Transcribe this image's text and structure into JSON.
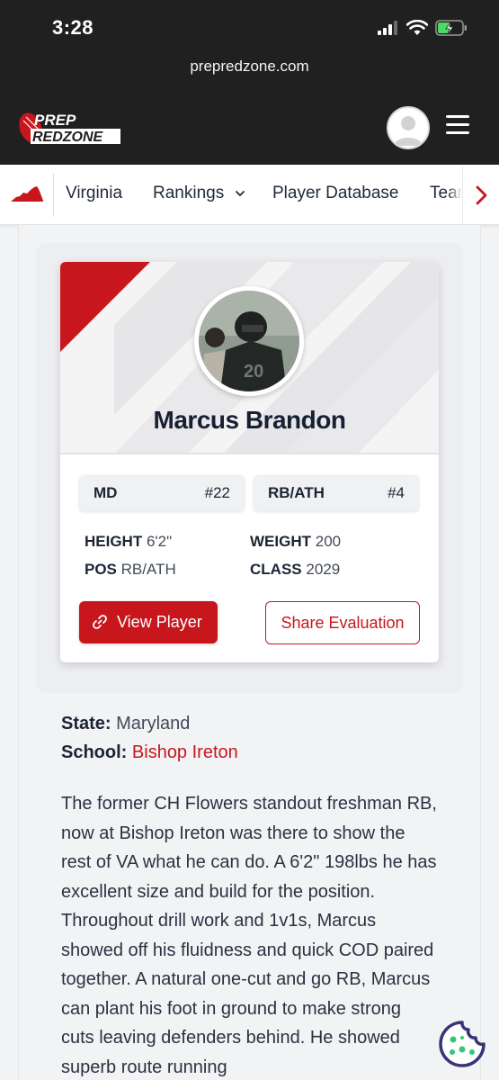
{
  "status_bar": {
    "time": "3:28"
  },
  "browser": {
    "url": "prepredzone.com"
  },
  "header": {
    "logo_top": "PREP",
    "logo_bottom": "REDZONE"
  },
  "nav": {
    "state_icon": "virginia-state-icon",
    "items": [
      "Virginia",
      "Rankings",
      "Player Database",
      "Teams"
    ],
    "more_icon": "chevron-right-icon"
  },
  "player": {
    "name": "Marcus Brandon",
    "state_rank": {
      "label": "MD",
      "value": "#22"
    },
    "position_rank": {
      "label": "RB/ATH",
      "value": "#4"
    },
    "stats": {
      "height_label": "HEIGHT",
      "height": "6'2\"",
      "weight_label": "WEIGHT",
      "weight": "200",
      "pos_label": "POS",
      "pos": "RB/ATH",
      "class_label": "CLASS",
      "class": "2029"
    },
    "view_button": "View Player",
    "share_button": "Share Evaluation"
  },
  "details": {
    "state_label": "State:",
    "state": "Maryland",
    "school_label": "School:",
    "school": "Bishop Ireton"
  },
  "evaluation": "The former CH Flowers standout freshman RB, now at Bishop Ireton was there to show the rest of VA what he can do. A 6'2\" 198lbs he has excellent size and build for the position. Throughout drill work and 1v1s, Marcus showed off his fluidness and quick COD paired together. A natural one-cut and go RB, Marcus can plant his foot in ground to make strong cuts leaving defenders behind. He showed superb route running",
  "colors": {
    "brand_red": "#c8161d",
    "header_dark": "#202020",
    "text_dark": "#1c2434"
  }
}
